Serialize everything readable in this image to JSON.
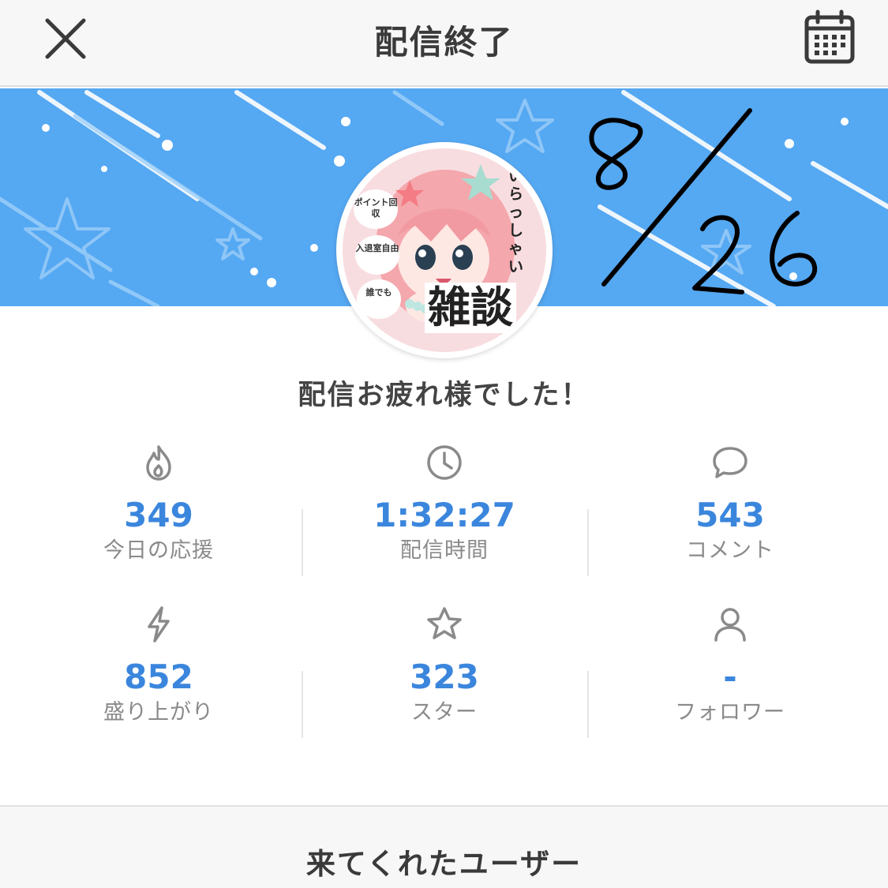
{
  "header": {
    "title": "配信終了",
    "close_icon": "close-icon",
    "calendar_icon": "calendar-icon"
  },
  "banner": {
    "background_color": "#55a8f2",
    "handwritten_date": "8/26"
  },
  "avatar": {
    "caption_big": "雑談",
    "caption_vertical": "いらっしゃい",
    "bubbles": [
      "ポイント回収",
      "入退室自由",
      "誰でも"
    ]
  },
  "message": "配信お疲れ様でした！",
  "stats": [
    {
      "icon": "flame-icon",
      "value": "349",
      "label": "今日の応援"
    },
    {
      "icon": "clock-icon",
      "value": "1:32:27",
      "label": "配信時間"
    },
    {
      "icon": "comment-icon",
      "value": "543",
      "label": "コメント"
    },
    {
      "icon": "lightning-icon",
      "value": "852",
      "label": "盛り上がり"
    },
    {
      "icon": "star-icon",
      "value": "323",
      "label": "スター"
    },
    {
      "icon": "user-icon",
      "value": "-",
      "label": "フォロワー"
    }
  ],
  "accent_color": "#3b86dd",
  "users_section": {
    "title": "来てくれたユーザー"
  }
}
